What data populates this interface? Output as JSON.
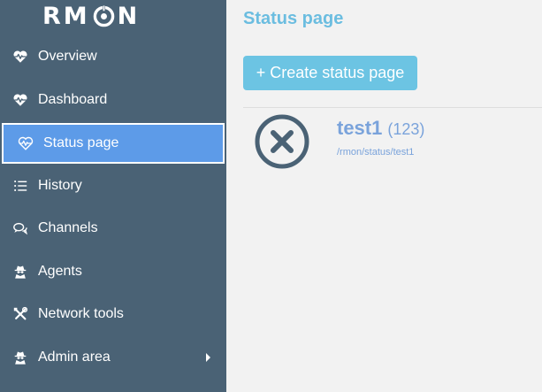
{
  "app": {
    "logo_text": {
      "left": "RM",
      "right": "N"
    }
  },
  "sidebar": {
    "items": [
      {
        "label": "Overview",
        "icon": "heartbeat-icon"
      },
      {
        "label": "Dashboard",
        "icon": "heartbeat-icon"
      },
      {
        "label": "Status page",
        "icon": "heartbeat-icon",
        "active": true
      },
      {
        "label": "History",
        "icon": "list-icon"
      },
      {
        "label": "Channels",
        "icon": "comments-icon"
      },
      {
        "label": "Agents",
        "icon": "user-secret-icon"
      },
      {
        "label": "Network tools",
        "icon": "tools-icon"
      },
      {
        "label": "Admin area",
        "icon": "user-secret-icon",
        "has_submenu": true
      }
    ]
  },
  "main": {
    "title": "Status page",
    "create_button_label": "+ Create status page",
    "status_pages": [
      {
        "name": "test1",
        "count": "(123)",
        "link": "/rmon/status/test1",
        "state_icon": "circle-x-icon"
      }
    ]
  },
  "colors": {
    "sidebar_bg": "#4a6275",
    "active_item_bg": "#5d9be8",
    "accent": "#6cc4e3",
    "title": "#6bbde0",
    "link": "#7aa3db",
    "status_icon": "#4a6275"
  }
}
